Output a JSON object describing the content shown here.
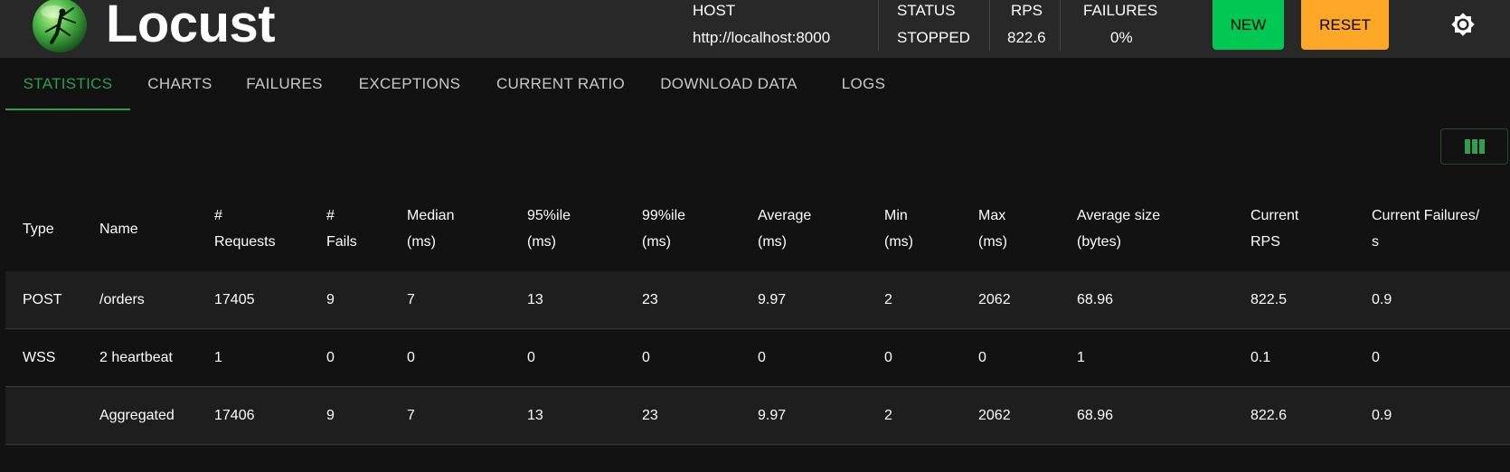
{
  "header": {
    "brand": "Locust",
    "host": {
      "label": "HOST",
      "value": "http://localhost:8000"
    },
    "status": {
      "label": "STATUS",
      "value": "STOPPED"
    },
    "rps": {
      "label": "RPS",
      "value": "822.6"
    },
    "failures": {
      "label": "FAILURES",
      "value": "0%"
    },
    "new_label": "NEW",
    "reset_label": "RESET",
    "icons": {
      "logo": "locust-logo-icon",
      "theme": "brightness-icon"
    },
    "colors": {
      "new": "#00c853",
      "reset": "#ffa726",
      "accent": "#2e9e4f"
    }
  },
  "tabs": [
    {
      "label": "STATISTICS",
      "active": true
    },
    {
      "label": "CHARTS"
    },
    {
      "label": "FAILURES"
    },
    {
      "label": "EXCEPTIONS"
    },
    {
      "label": "CURRENT RATIO"
    },
    {
      "label": "DOWNLOAD DATA"
    },
    {
      "label": "LOGS"
    }
  ],
  "column_toggle_icon": "view-column-icon",
  "table": {
    "columns": [
      {
        "l1": "Type",
        "l2": ""
      },
      {
        "l1": "Name",
        "l2": ""
      },
      {
        "l1": "#",
        "l2": "Requests"
      },
      {
        "l1": "#",
        "l2": "Fails"
      },
      {
        "l1": "Median",
        "l2": "(ms)"
      },
      {
        "l1": "95%ile",
        "l2": "(ms)"
      },
      {
        "l1": "99%ile",
        "l2": "(ms)"
      },
      {
        "l1": "Average",
        "l2": "(ms)"
      },
      {
        "l1": "Min",
        "l2": "(ms)"
      },
      {
        "l1": "Max",
        "l2": "(ms)"
      },
      {
        "l1": "Average size",
        "l2": "(bytes)"
      },
      {
        "l1": "Current",
        "l2": "RPS"
      },
      {
        "l1": "Current Failures/",
        "l2": "s"
      }
    ],
    "rows": [
      [
        "POST",
        "/orders",
        "17405",
        "9",
        "7",
        "13",
        "23",
        "9.97",
        "2",
        "2062",
        "68.96",
        "822.5",
        "0.9"
      ],
      [
        "WSS",
        "2 heartbeat",
        "1",
        "0",
        "0",
        "0",
        "0",
        "0",
        "0",
        "0",
        "1",
        "0.1",
        "0"
      ],
      [
        "",
        "Aggregated",
        "17406",
        "9",
        "7",
        "13",
        "23",
        "9.97",
        "2",
        "2062",
        "68.96",
        "822.6",
        "0.9"
      ]
    ]
  }
}
